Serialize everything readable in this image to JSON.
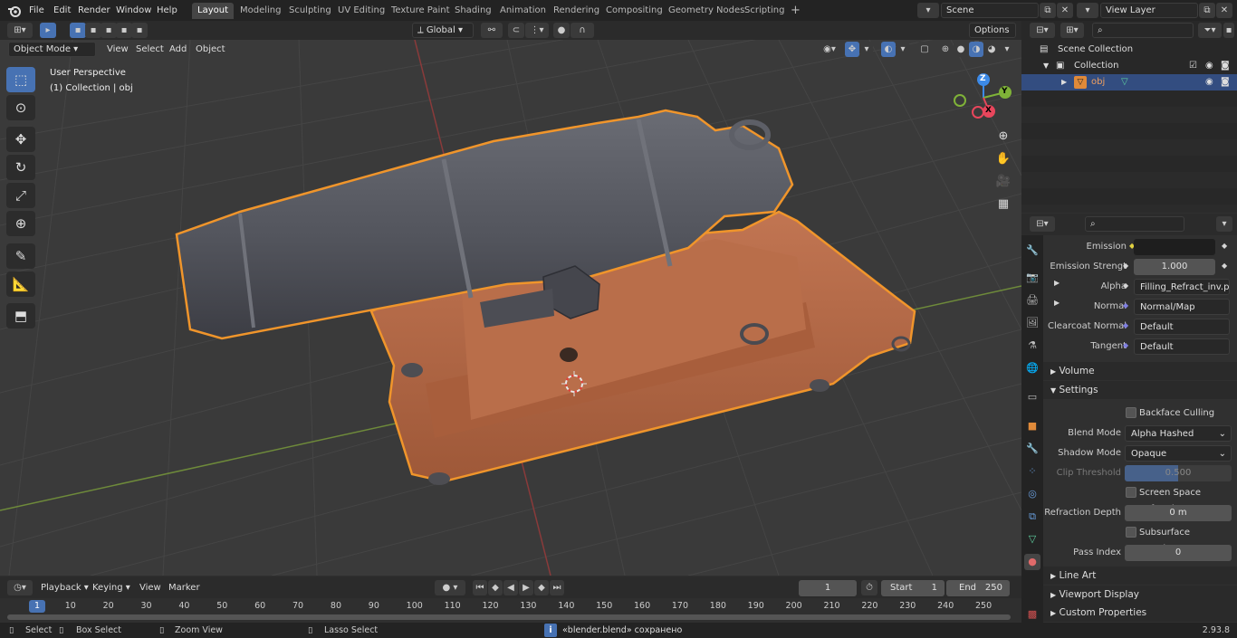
{
  "topbar": {
    "menus": [
      "File",
      "Edit",
      "Render",
      "Window",
      "Help"
    ],
    "workspaces": [
      "Layout",
      "Modeling",
      "Sculpting",
      "UV Editing",
      "Texture Paint",
      "Shading",
      "Animation",
      "Rendering",
      "Compositing",
      "Geometry Nodes",
      "Scripting"
    ],
    "active_workspace": "Layout",
    "add_tab": "+",
    "scene": "Scene",
    "view_layer": "View Layer"
  },
  "viewport_header": {
    "mode": "Object Mode",
    "menus": [
      "View",
      "Select",
      "Add",
      "Object"
    ],
    "orientation": "Global",
    "options": "Options"
  },
  "viewport": {
    "perspective": "User Perspective",
    "collection_info": "(1) Collection | obj",
    "gizmo": {
      "x": "X",
      "y": "Y",
      "z": "Z"
    }
  },
  "outliner": {
    "search_placeholder": "",
    "scene_collection": "Scene Collection",
    "collection": "Collection",
    "object": "obj"
  },
  "properties": {
    "rows": [
      {
        "label": "Emission",
        "value": ""
      },
      {
        "label": "Emission Strengt",
        "value": "1.000"
      },
      {
        "label": "Alpha",
        "value": "Filling_Refract_inv.p..."
      },
      {
        "label": "Normal",
        "value": "Normal/Map"
      },
      {
        "label": "Clearcoat Normal",
        "value": "Default"
      },
      {
        "label": "Tangent",
        "value": "Default"
      }
    ],
    "volume": "Volume",
    "settings": "Settings",
    "backface_culling": "Backface Culling",
    "blend_mode_label": "Blend Mode",
    "blend_mode": "Alpha Hashed",
    "shadow_mode_label": "Shadow Mode",
    "shadow_mode": "Opaque",
    "clip_threshold_label": "Clip Threshold",
    "clip_threshold": "0.500",
    "clip_threshold_fraction": 0.5,
    "screen_space_refraction": "Screen Space Refraction",
    "refraction_depth_label": "Refraction Depth",
    "refraction_depth": "0 m",
    "subsurface_translucency": "Subsurface Translucency",
    "pass_index_label": "Pass Index",
    "pass_index": "0",
    "line_art": "Line Art",
    "viewport_display": "Viewport Display",
    "custom_properties": "Custom Properties"
  },
  "timeline": {
    "menus": [
      "Playback",
      "Keying",
      "View",
      "Marker"
    ],
    "current_frame": "1",
    "start_label": "Start",
    "start": "1",
    "end_label": "End",
    "end": "250",
    "ticks": [
      "1",
      "10",
      "20",
      "30",
      "40",
      "50",
      "60",
      "70",
      "80",
      "90",
      "100",
      "110",
      "120",
      "130",
      "140",
      "150",
      "160",
      "170",
      "180",
      "190",
      "200",
      "210",
      "220",
      "230",
      "240",
      "250"
    ]
  },
  "statusbar": {
    "select": "Select",
    "box_select": "Box Select",
    "zoom_view": "Zoom View",
    "lasso_select": "Lasso Select",
    "message": "«blender.blend» сохранено",
    "version": "2.93.8"
  },
  "colors": {
    "accent": "#4772b3",
    "selection_outline": "#f0952b",
    "cannon_barrel": "#5a5c64",
    "carriage": "#b86a47",
    "x_axis": "#e8465c",
    "y_axis": "#7fb238",
    "z_axis": "#3c8ae8"
  }
}
